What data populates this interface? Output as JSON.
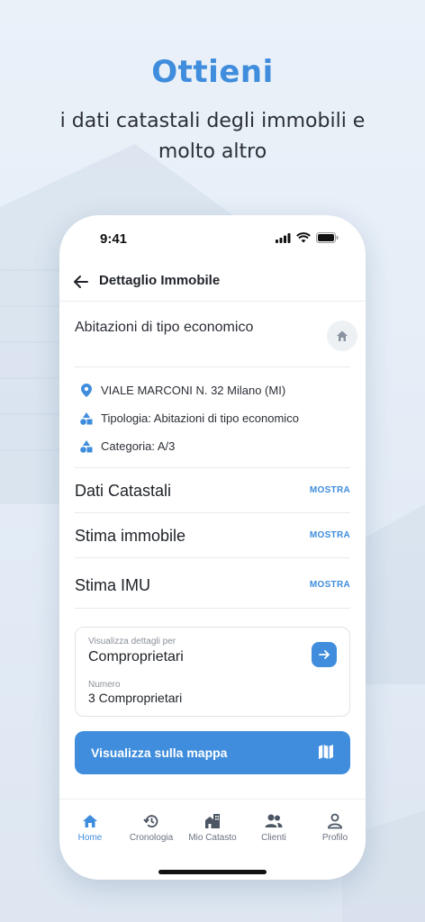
{
  "promo": {
    "title": "Ottieni",
    "subtitle_line1": "i dati catastali degli immobili e",
    "subtitle_line2": "molto altro"
  },
  "statusbar": {
    "time": "9:41"
  },
  "appbar": {
    "title": "Dettaglio Immobile"
  },
  "property": {
    "name": "Abitazioni di tipo economico",
    "address": "VIALE MARCONI N. 32 Milano (MI)",
    "tipologia": "Tipologia: Abitazioni di tipo economico",
    "categoria": "Categoria: A/3"
  },
  "sections": [
    {
      "label": "Dati Catastali",
      "action": "MOSTRA"
    },
    {
      "label": "Stima immobile",
      "action": "MOSTRA"
    },
    {
      "label": "Stima IMU",
      "action": "MOSTRA"
    }
  ],
  "owners": {
    "details_label": "Visualizza dettagli per",
    "details_value": "Comproprietari",
    "number_label": "Numero",
    "number_value": "3 Comproprietari"
  },
  "map_button": {
    "label": "Visualizza sulla mappa"
  },
  "tabs": [
    {
      "label": "Home",
      "icon": "home-icon"
    },
    {
      "label": "Cronologia",
      "icon": "history-icon"
    },
    {
      "label": "Mio Catasto",
      "icon": "buildings-icon"
    },
    {
      "label": "Clienti",
      "icon": "people-icon"
    },
    {
      "label": "Profilo",
      "icon": "person-icon"
    }
  ],
  "colors": {
    "accent": "#3f8ddc",
    "background": "#e8f0f8"
  }
}
